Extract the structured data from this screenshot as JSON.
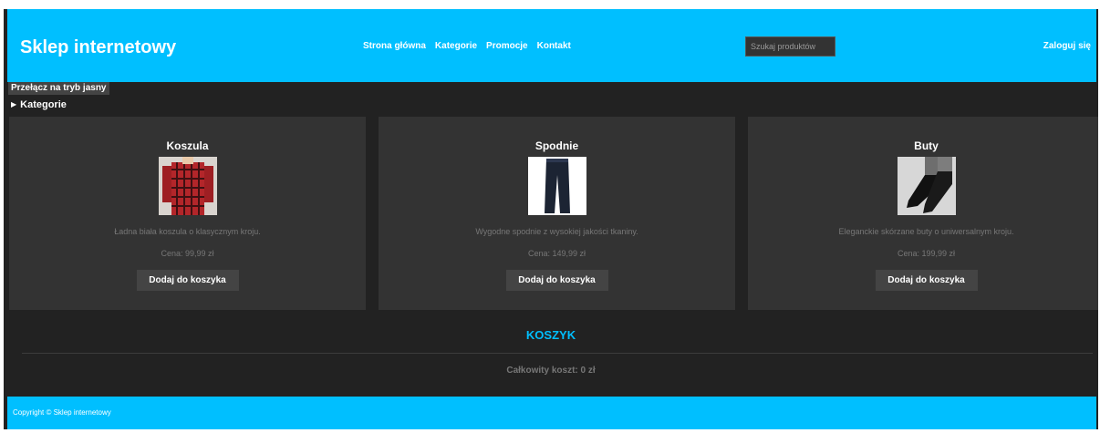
{
  "header": {
    "title": "Sklep internetowy",
    "nav": [
      "Strona główna",
      "Kategorie",
      "Promocje",
      "Kontakt"
    ],
    "search_placeholder": "Szukaj produktów",
    "login": "Zaloguj się"
  },
  "theme_toggle": "Przełącz na tryb jasny",
  "categories_label": "Kategorie",
  "products": [
    {
      "name": "Koszula",
      "description": "Ładna biała koszula o klasycznym kroju.",
      "price": "Cena: 99,99 zł",
      "button": "Dodaj do koszyka",
      "image_icon": "shirt-image"
    },
    {
      "name": "Spodnie",
      "description": "Wygodne spodnie z wysokiej jakości tkaniny.",
      "price": "Cena: 149,99 zł",
      "button": "Dodaj do koszyka",
      "image_icon": "pants-image"
    },
    {
      "name": "Buty",
      "description": "Eleganckie skórzane buty o uniwersalnym kroju.",
      "price": "Cena: 199,99 zł",
      "button": "Dodaj do koszyka",
      "image_icon": "shoes-image"
    }
  ],
  "cart": {
    "title": "KOSZYK",
    "total": "Całkowity koszt: 0 zł"
  },
  "footer": {
    "copyright": "Copyright © Sklep internetowy"
  },
  "colors": {
    "accent": "#00bfff",
    "background": "#222222",
    "card": "#333333",
    "button": "#444444"
  }
}
